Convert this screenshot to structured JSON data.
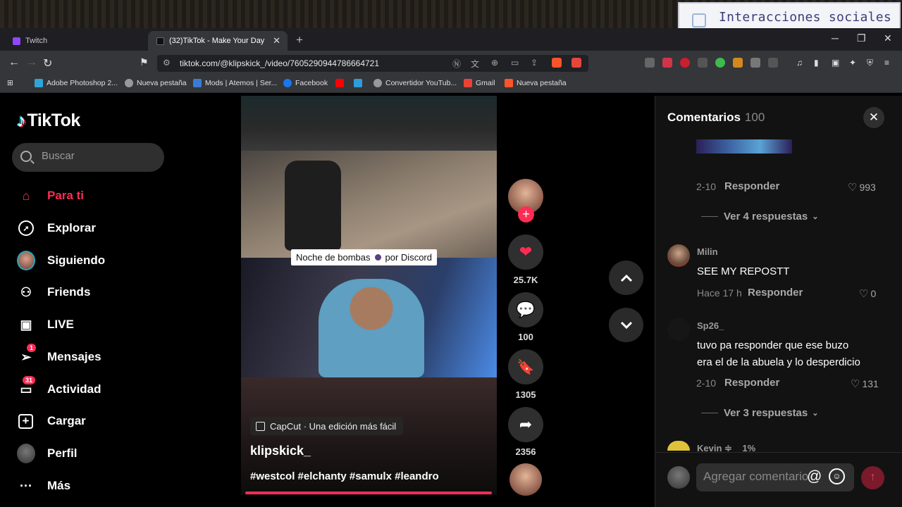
{
  "overlay": {
    "text": "Interacciones sociales"
  },
  "browser": {
    "tabs": [
      {
        "label": "Twitch"
      },
      {
        "label": "(32)TikTok - Make Your Day"
      }
    ],
    "url": "tiktok.com/@klipskick_/video/7605290944786664721",
    "bookmarks": [
      {
        "label": "Adobe Photoshop 2..."
      },
      {
        "label": "Nueva pestaña"
      },
      {
        "label": "Mods | Atemos | Ser..."
      },
      {
        "label": "Facebook"
      },
      {
        "label": "Convertidor YouTub..."
      },
      {
        "label": "Gmail"
      },
      {
        "label": "Nueva pestaña"
      }
    ]
  },
  "sidebar": {
    "logo": "TikTok",
    "search_placeholder": "Buscar",
    "items": [
      {
        "label": "Para ti"
      },
      {
        "label": "Explorar"
      },
      {
        "label": "Siguiendo"
      },
      {
        "label": "Friends"
      },
      {
        "label": "LIVE"
      },
      {
        "label": "Mensajes",
        "badge": "1"
      },
      {
        "label": "Actividad",
        "badge": "31"
      },
      {
        "label": "Cargar"
      },
      {
        "label": "Perfil"
      },
      {
        "label": "Más"
      }
    ]
  },
  "video": {
    "discord_tag_left": "Noche de bombas",
    "discord_tag_right": "por Discord",
    "capcut": "CapCut · Una edición más fácil",
    "author": "klipskick_",
    "hashtags": "#westcol #elchanty #samulx #leandro",
    "progress": 1.0
  },
  "actions": {
    "likes": "25.7K",
    "comments": "100",
    "saves": "1305",
    "shares": "2356"
  },
  "comments": {
    "title": "Comentarios",
    "count": "100",
    "items": [
      {
        "date": "2-10",
        "reply": "Responder",
        "likes": "993",
        "more": "Ver 4 respuestas"
      },
      {
        "user": "Milin",
        "text": "SEE MY REPOSTT",
        "date": "Hace 17 h",
        "reply": "Responder",
        "likes": "0"
      },
      {
        "user": "Sp26_",
        "text1": "tuvo pa responder que ese buzo",
        "text2": "era el de la abuela y lo desperdicio",
        "date": "2-10",
        "reply": "Responder",
        "likes": "131",
        "more": "Ver 3 respuestas"
      },
      {
        "user": "Kevin ≑ _ 1%"
      }
    ],
    "input_placeholder": "Agregar comentario..."
  },
  "colors": {
    "accent": "#fe2c55",
    "background": "#000000",
    "panel": "#121212"
  }
}
